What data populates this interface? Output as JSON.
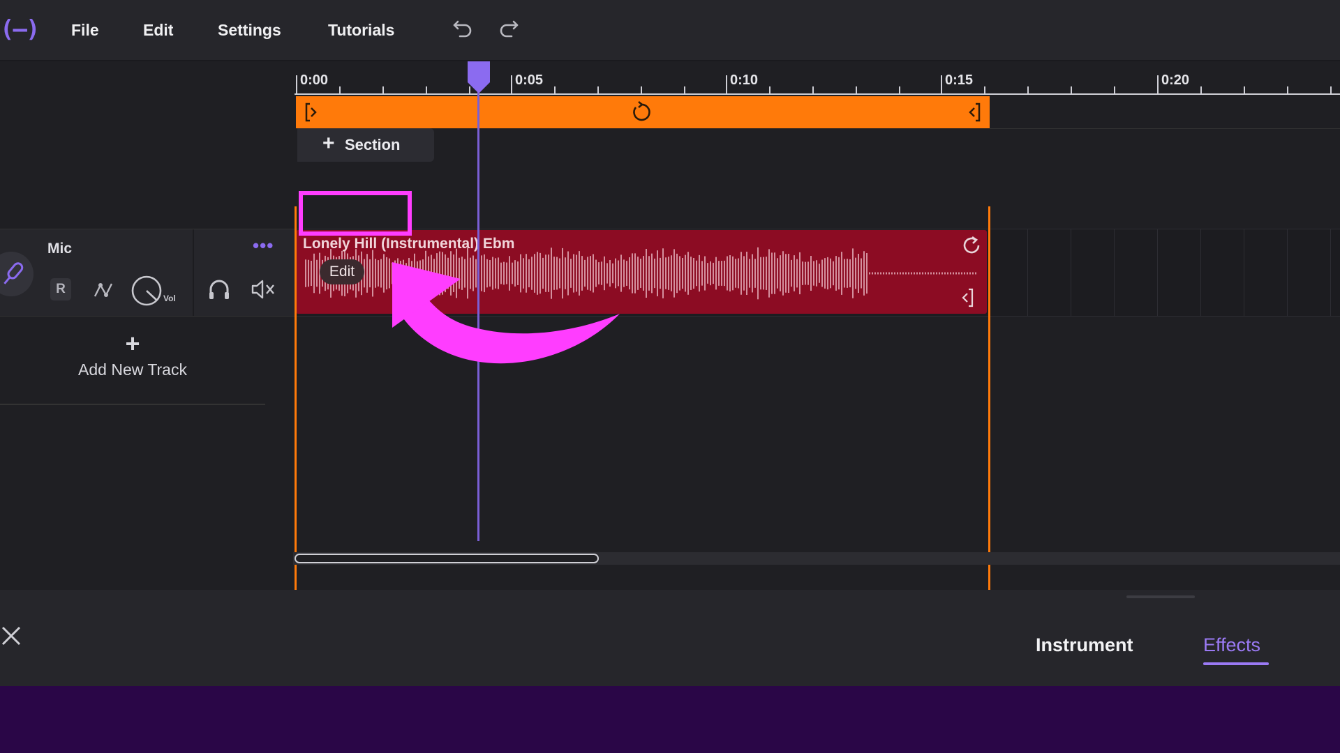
{
  "app": {
    "logo_text": "(—)",
    "accent_color": "#8b6bf0"
  },
  "menu": {
    "items": [
      "File",
      "Edit",
      "Settings",
      "Tutorials"
    ],
    "undo_icon": "undo-icon",
    "redo_icon": "redo-icon"
  },
  "ruler": {
    "labels": [
      "0:00",
      "0:05",
      "0:10",
      "0:15",
      "0:20"
    ]
  },
  "section": {
    "add_label": "Section"
  },
  "track": {
    "name": "Mic",
    "record_label": "R",
    "volume_label": "Vol",
    "more_icon": "more-dots-icon",
    "mic_icon": "microphone-icon",
    "automation_icon": "automation-icon",
    "headphones_icon": "headphones-icon",
    "mute_icon": "mute-icon"
  },
  "clip": {
    "name": "Lonely Hill (Instrumental) Ebm",
    "edit_label": "Edit",
    "color": "#8c0c23"
  },
  "add_track": {
    "plus": "+",
    "label": "Add New Track"
  },
  "loop_region": {
    "color": "#ff7a0a"
  },
  "bottom_panel": {
    "tabs": [
      {
        "label": "Instrument",
        "active": false
      },
      {
        "label": "Effects",
        "active": true
      }
    ],
    "close_icon": "close-icon"
  },
  "annotation": {
    "highlight_color": "#ff3dff",
    "arrow_icon": "curved-arrow-icon"
  }
}
